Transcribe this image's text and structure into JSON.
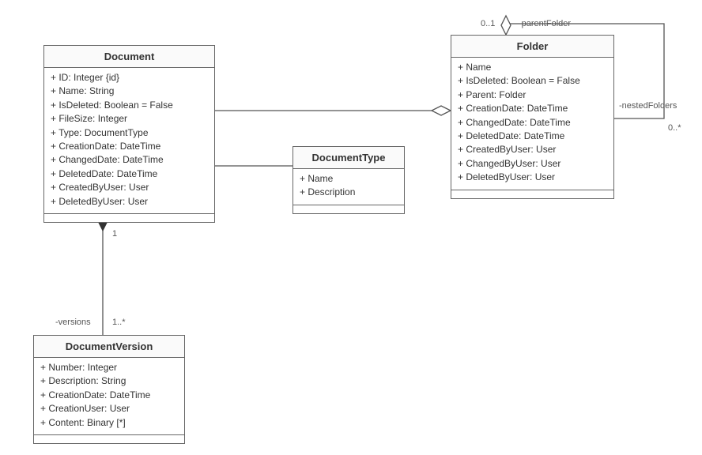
{
  "diagram": {
    "classes": {
      "document": {
        "title": "Document",
        "attrs": [
          "+ ID: Integer {id}",
          "+ Name: String",
          "+ IsDeleted: Boolean = False",
          "+ FileSize: Integer",
          "+ Type: DocumentType",
          "+ CreationDate: DateTime",
          "+ ChangedDate: DateTime",
          "+ DeletedDate: DateTime",
          "+ CreatedByUser: User",
          "+ DeletedByUser: User"
        ]
      },
      "documentType": {
        "title": "DocumentType",
        "attrs": [
          "+ Name",
          "+ Description"
        ]
      },
      "folder": {
        "title": "Folder",
        "attrs": [
          "+ Name",
          "+ IsDeleted: Boolean = False",
          "+ Parent: Folder",
          "+ CreationDate: DateTime",
          "+ ChangedDate: DateTime",
          "+ DeletedDate: DateTime",
          "+ CreatedByUser: User",
          "+ ChangedByUser: User",
          "+ DeletedByUser: User"
        ]
      },
      "documentVersion": {
        "title": "DocumentVersion",
        "attrs": [
          "+ Number: Integer",
          "+ Description: String",
          "+ CreationDate: DateTime",
          "+ CreationUser: User",
          "+ Content: Binary [*]"
        ]
      }
    },
    "assoc_labels": {
      "doc_one": "1",
      "versions_role": "-versions",
      "versions_mult": "1..*",
      "parentFolder_role": "-parentFolder",
      "parentFolder_mult": "0..1",
      "nestedFolders_role": "-nestedFolders",
      "nestedFolders_mult": "0..*"
    }
  }
}
